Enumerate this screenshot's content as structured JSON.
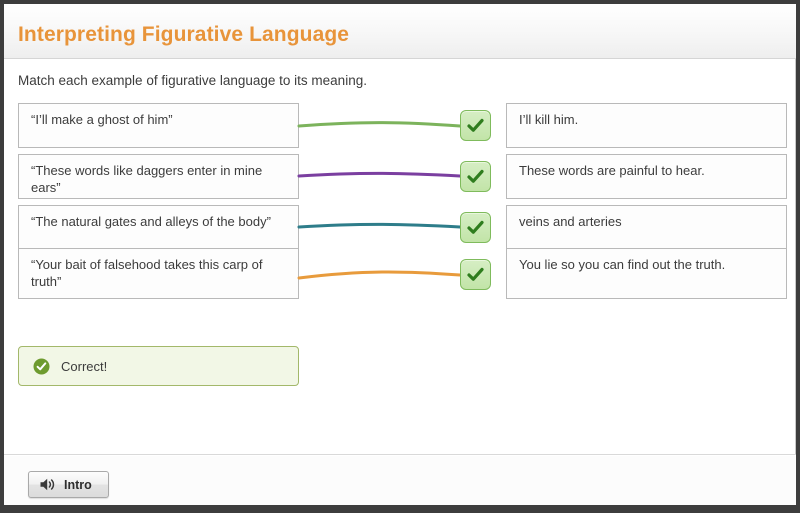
{
  "header": {
    "title": "Interpreting Figurative Language",
    "title_color": "#e8943a"
  },
  "instruction": "Match each example of figurative language to its meaning.",
  "match": {
    "left_items": [
      {
        "text": "“I’ll make a ghost of him”"
      },
      {
        "text": "“These words like daggers enter in mine ears”"
      },
      {
        "text": "“The natural gates and alleys of the body”"
      },
      {
        "text": "“Your bait of falsehood takes this carp of truth”"
      }
    ],
    "right_items": [
      {
        "text": "I’ll kill him."
      },
      {
        "text": "These words are painful to hear."
      },
      {
        "text": "veins and arteries"
      },
      {
        "text": "You lie so you can find out the truth."
      }
    ],
    "connectors": [
      {
        "color": "#7cb35c",
        "from": 0,
        "to": 0
      },
      {
        "color": "#7b3fa0",
        "from": 1,
        "to": 1
      },
      {
        "color": "#2e7d8a",
        "from": 2,
        "to": 2
      },
      {
        "color": "#e89b3c",
        "from": 3,
        "to": 3
      }
    ],
    "check_icon": "check-icon",
    "check_count": 4
  },
  "feedback": {
    "text": "Correct!",
    "icon": "check-circle-icon",
    "accent_color": "#6e9b2f",
    "background": "#f2f7e6",
    "border": "#a3b86a"
  },
  "footer": {
    "intro_label": "Intro",
    "intro_icon": "speaker-icon"
  }
}
